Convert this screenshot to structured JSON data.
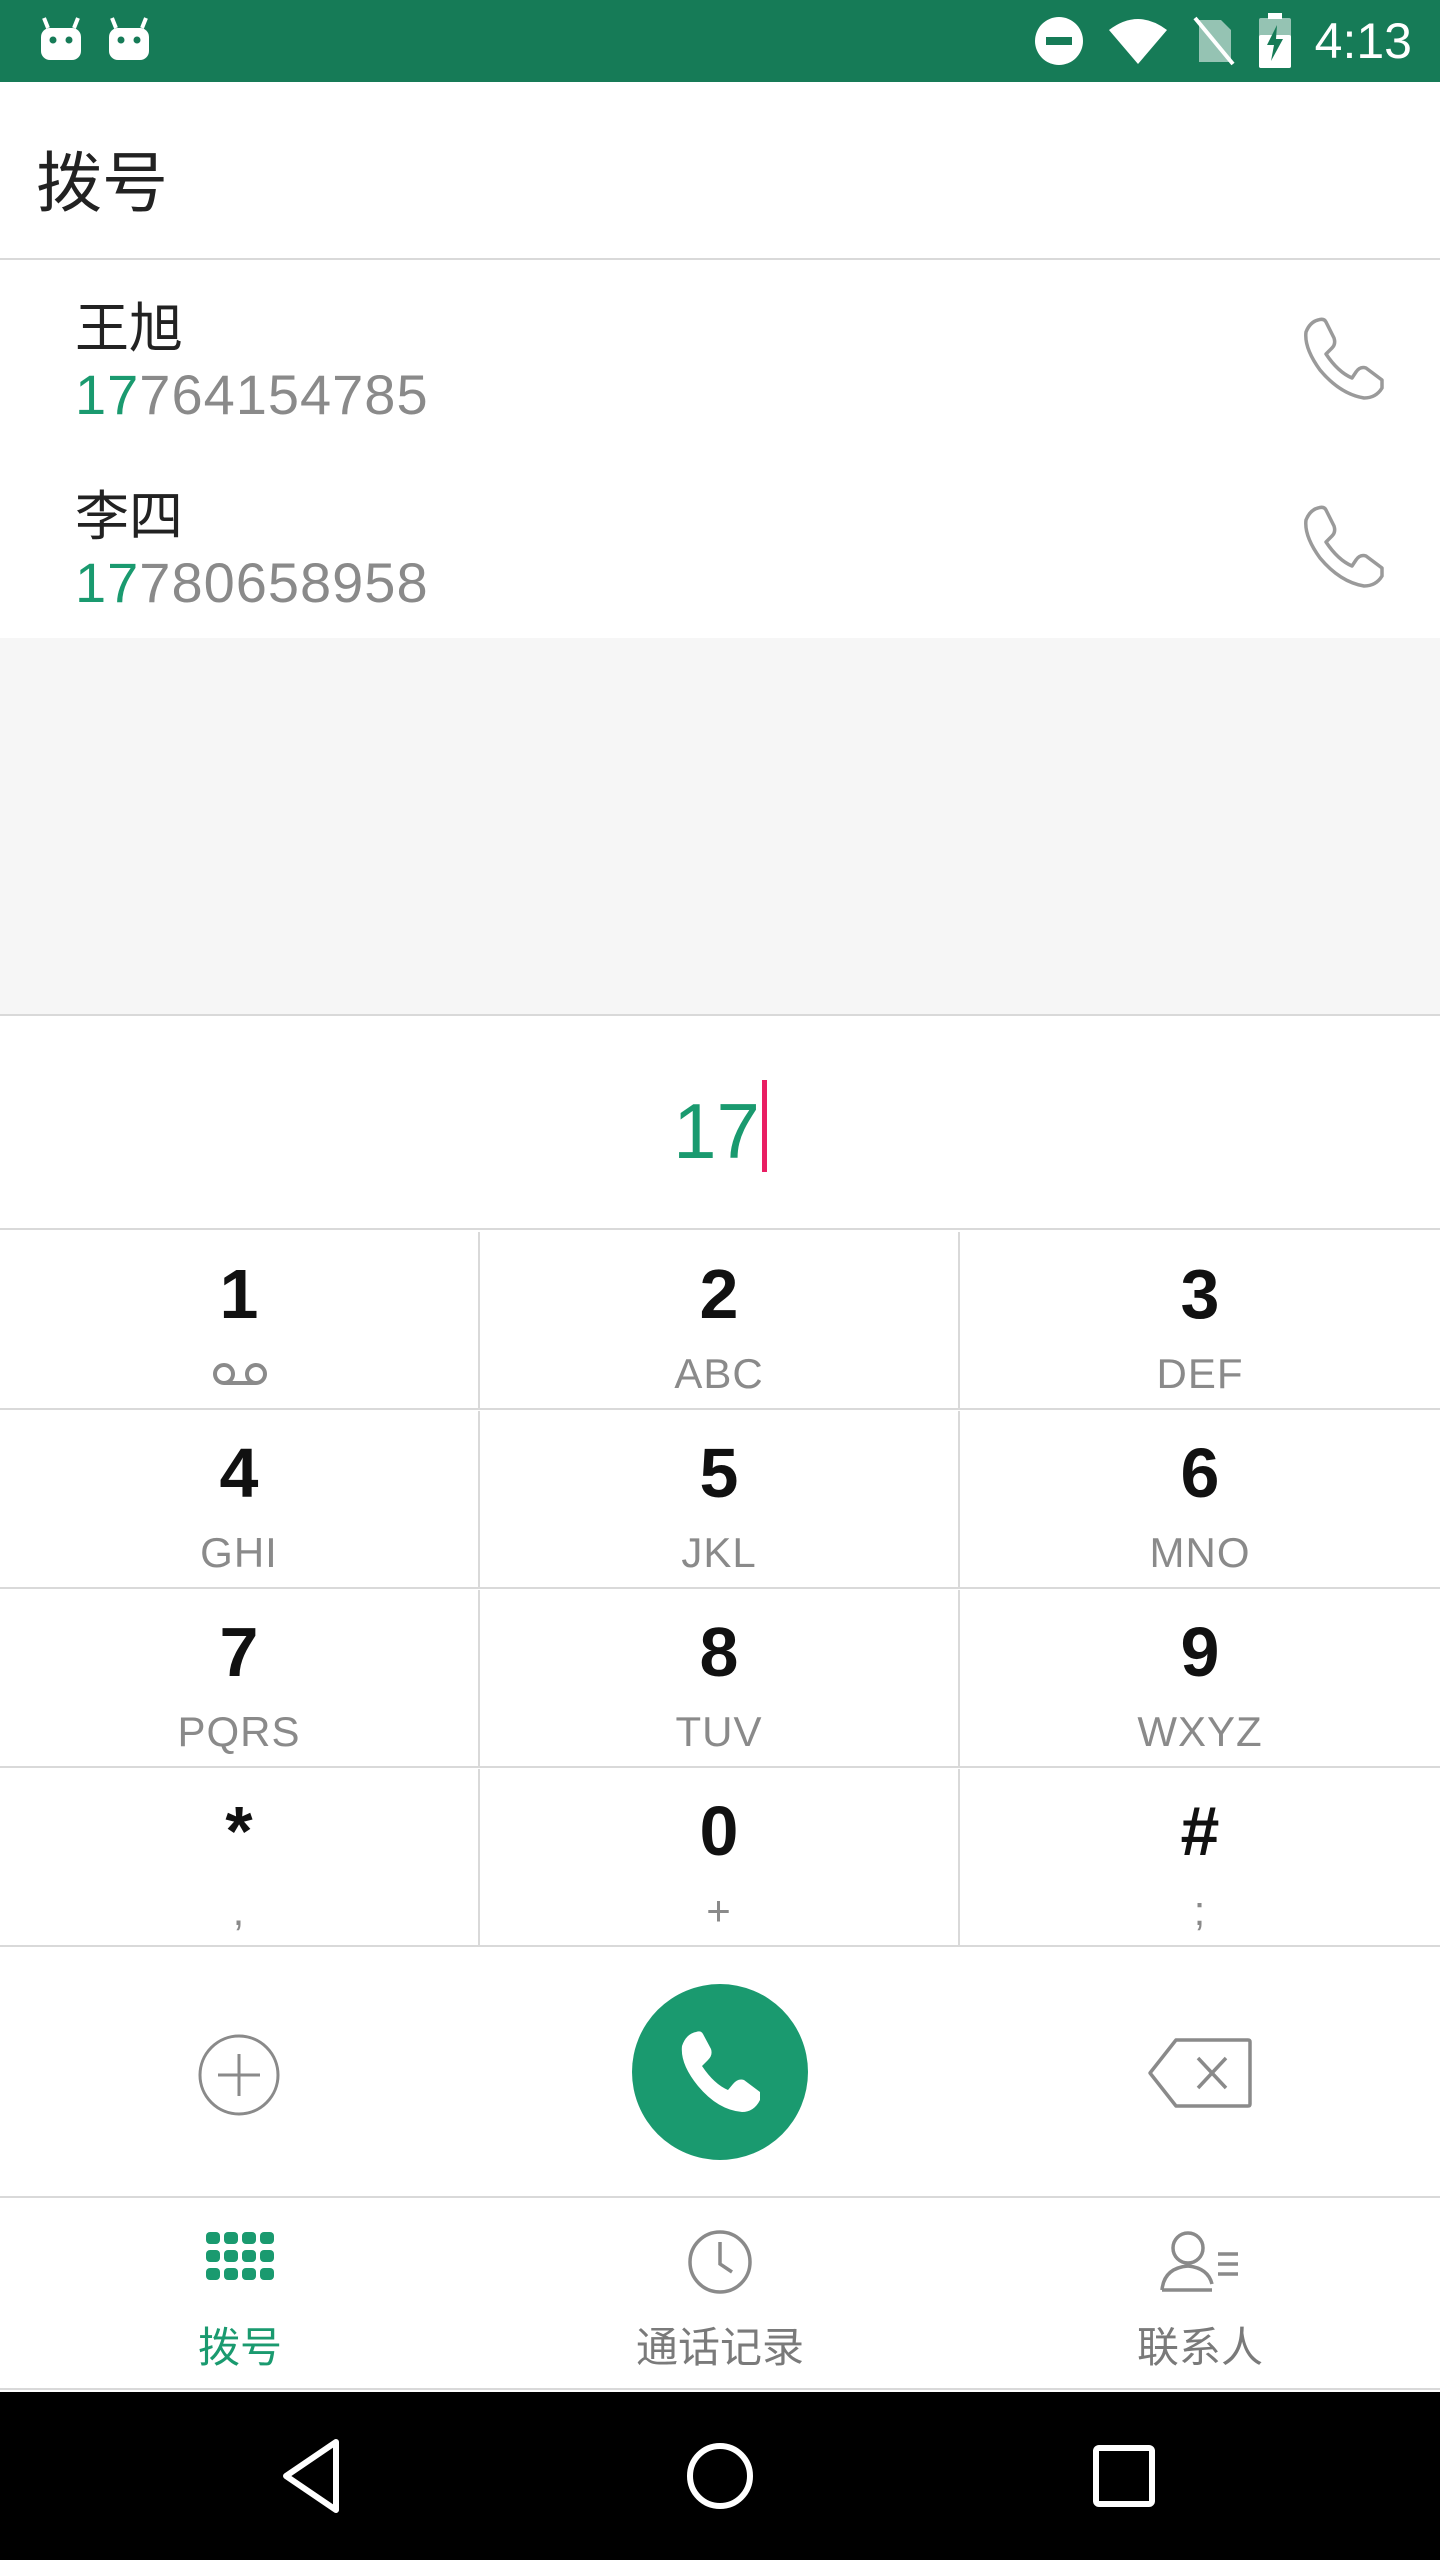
{
  "status_bar": {
    "time": "4:13",
    "left_icons": [
      "android-icon",
      "android-icon"
    ],
    "right_icons": [
      "do-not-disturb-icon",
      "wifi-icon",
      "no-sim-icon",
      "battery-charging-icon"
    ],
    "background_color": "#167b57"
  },
  "app_bar": {
    "title": "拨号"
  },
  "results": [
    {
      "name": "王旭",
      "number_match": "17",
      "number_rest": "764154785"
    },
    {
      "name": "李四",
      "number_match": "17",
      "number_rest": "780658958"
    }
  ],
  "dial_input": {
    "value": "17"
  },
  "keypad": [
    {
      "digit": "1",
      "letters": "",
      "icon": "voicemail-icon"
    },
    {
      "digit": "2",
      "letters": "ABC"
    },
    {
      "digit": "3",
      "letters": "DEF"
    },
    {
      "digit": "4",
      "letters": "GHI"
    },
    {
      "digit": "5",
      "letters": "JKL"
    },
    {
      "digit": "6",
      "letters": "MNO"
    },
    {
      "digit": "7",
      "letters": "PQRS"
    },
    {
      "digit": "8",
      "letters": "TUV"
    },
    {
      "digit": "9",
      "letters": "WXYZ"
    },
    {
      "digit": "*",
      "letters": ","
    },
    {
      "digit": "0",
      "letters": "+"
    },
    {
      "digit": "#",
      "letters": ";"
    }
  ],
  "actions": {
    "add_icon": "add-circle-icon",
    "dial_icon": "phone-icon",
    "delete_icon": "backspace-icon"
  },
  "bottom_nav": [
    {
      "label": "拨号",
      "icon": "dialpad-icon",
      "active": true
    },
    {
      "label": "通话记录",
      "icon": "clock-icon",
      "active": false
    },
    {
      "label": "联系人",
      "icon": "contacts-icon",
      "active": false
    }
  ],
  "colors": {
    "accent": "#1a9a6f",
    "cursor": "#e91e63",
    "secondary_text": "#8a8a8a"
  }
}
